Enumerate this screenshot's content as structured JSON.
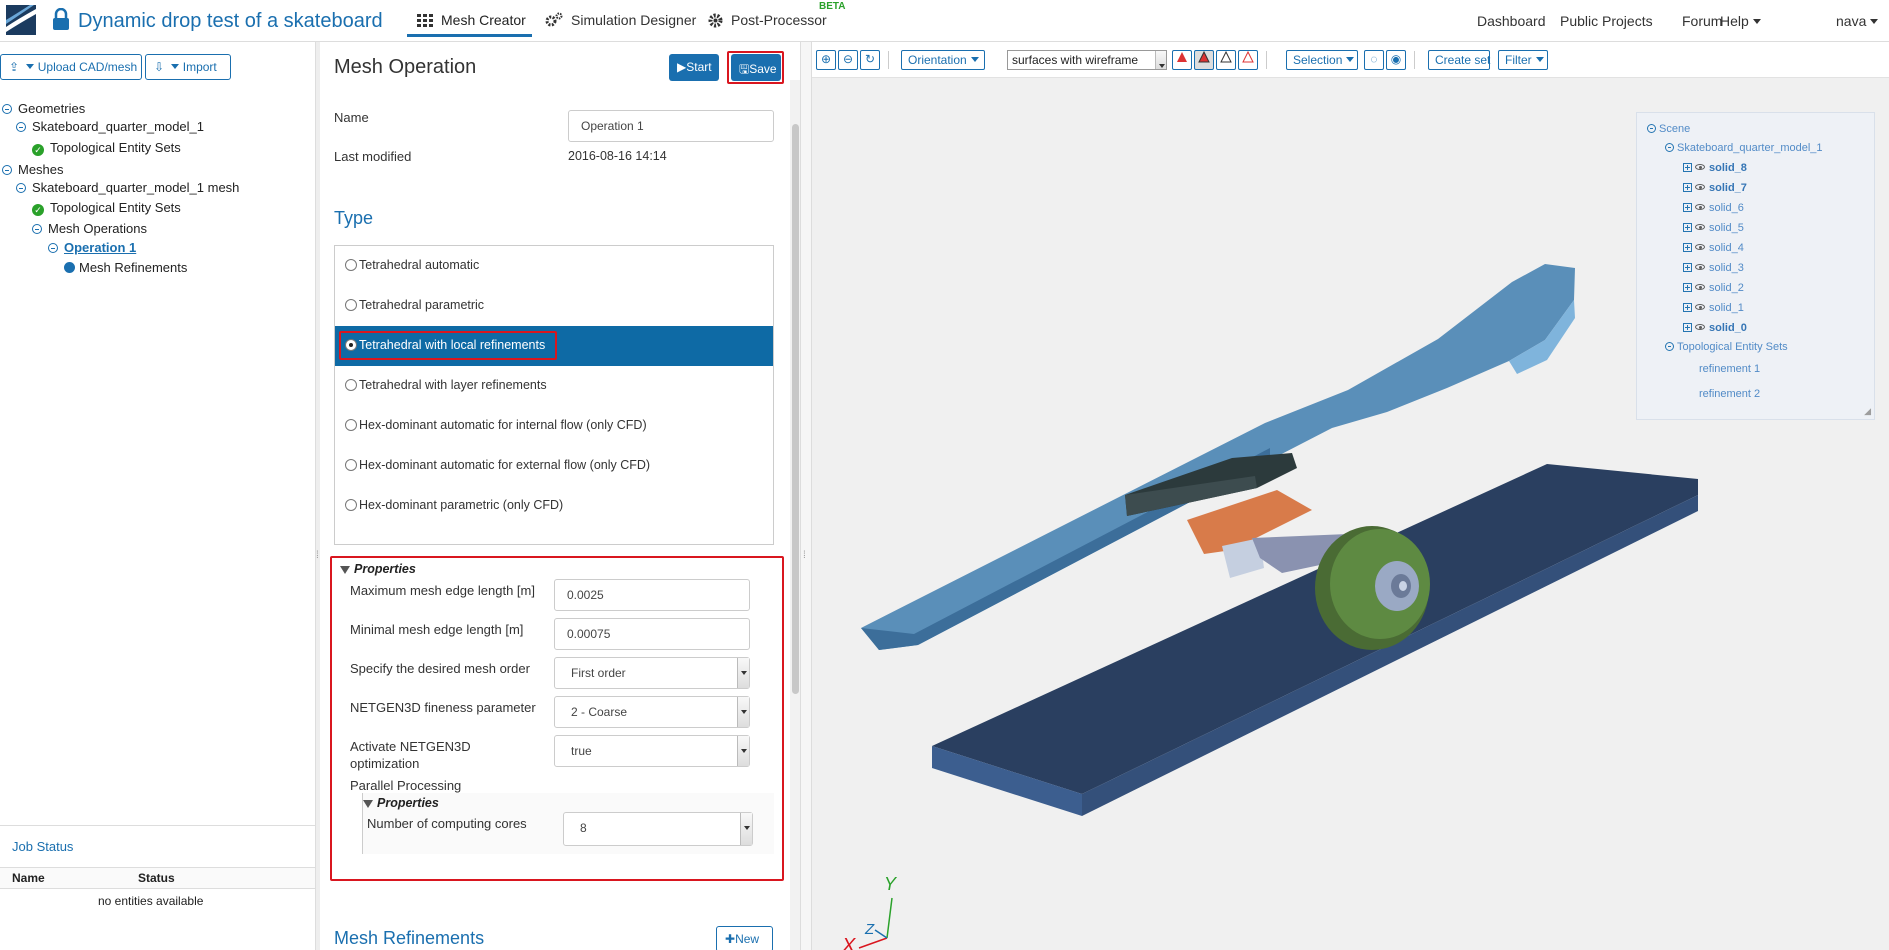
{
  "header": {
    "project_title": "Dynamic drop test of a skateboard",
    "tabs": [
      {
        "label": "Mesh Creator"
      },
      {
        "label": "Simulation Designer"
      },
      {
        "label": "Post-Processor"
      }
    ],
    "beta_badge": "BETA",
    "right_links": [
      "Dashboard",
      "Public Projects",
      "Forum",
      "Help"
    ],
    "user": "nava"
  },
  "left": {
    "upload_button": "Upload CAD/mesh",
    "import_button": "Import",
    "tree": {
      "geometries": "Geometries",
      "geo_model": "Skateboard_quarter_model_1",
      "geo_tes": "Topological Entity Sets",
      "meshes": "Meshes",
      "mesh_model": "Skateboard_quarter_model_1 mesh",
      "mesh_tes": "Topological Entity Sets",
      "mesh_ops": "Mesh Operations",
      "operation": "Operation 1",
      "refinements": "Mesh Refinements"
    },
    "job_status": {
      "title": "Job Status",
      "col_name": "Name",
      "col_status": "Status",
      "empty": "no entities available"
    }
  },
  "form": {
    "title": "Mesh Operation",
    "start_button": "Start",
    "save_button": "Save",
    "name_label": "Name",
    "name_value": "Operation 1",
    "modified_label": "Last modified",
    "modified_value": "2016-08-16 14:14",
    "type_heading": "Type",
    "types": [
      {
        "label": "Tetrahedral automatic",
        "selected": false
      },
      {
        "label": "Tetrahedral parametric",
        "selected": false
      },
      {
        "label": "Tetrahedral with local refinements",
        "selected": true
      },
      {
        "label": "Tetrahedral with layer refinements",
        "selected": false
      },
      {
        "label": "Hex-dominant automatic for internal flow (only CFD)",
        "selected": false
      },
      {
        "label": "Hex-dominant automatic for external flow (only CFD)",
        "selected": false
      },
      {
        "label": "Hex-dominant parametric (only CFD)",
        "selected": false
      }
    ],
    "properties_heading": "Properties",
    "max_edge_label": "Maximum mesh edge length [m]",
    "max_edge_value": "0.0025",
    "min_edge_label": "Minimal mesh edge length [m]",
    "min_edge_value": "0.00075",
    "order_label": "Specify the desired mesh order",
    "order_value": "First order",
    "fineness_label": "NETGEN3D fineness parameter",
    "fineness_value": "2 - Coarse",
    "optimization_label_1": "Activate NETGEN3D",
    "optimization_label_2": "optimization",
    "optimization_value": "true",
    "parallel_label": "Parallel Processing",
    "sub_properties_heading": "Properties",
    "cores_label": "Number of computing cores",
    "cores_value": "8",
    "refinements_heading": "Mesh Refinements",
    "new_button": "New"
  },
  "viewer": {
    "orientation": "Orientation",
    "render_mode": "surfaces with wireframe",
    "selection": "Selection",
    "create_set": "Create set",
    "filter": "Filter",
    "scene": {
      "root": "Scene",
      "model": "Skateboard_quarter_model_1",
      "solids": [
        {
          "label": "solid_8",
          "bold": true
        },
        {
          "label": "solid_7",
          "bold": true
        },
        {
          "label": "solid_6",
          "bold": false
        },
        {
          "label": "solid_5",
          "bold": false
        },
        {
          "label": "solid_4",
          "bold": false
        },
        {
          "label": "solid_3",
          "bold": false
        },
        {
          "label": "solid_2",
          "bold": false
        },
        {
          "label": "solid_1",
          "bold": false
        },
        {
          "label": "solid_0",
          "bold": true
        }
      ],
      "tes": "Topological Entity Sets",
      "refinements": [
        "refinement 1",
        "refinement 2"
      ]
    },
    "axes": {
      "x": "X",
      "y": "Y",
      "z": "Z"
    }
  },
  "colors": {
    "accent": "#1a6faf",
    "selected_row": "#0e6aa5",
    "highlight": "#d9161f",
    "success": "#2aa12a"
  }
}
